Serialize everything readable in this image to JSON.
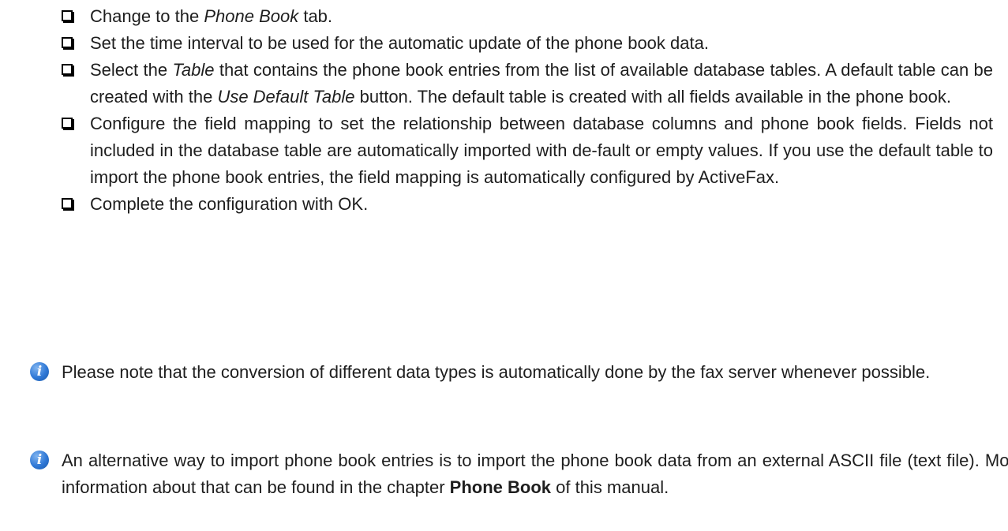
{
  "checklist": [
    {
      "a": "Change to the ",
      "b": "Phone Book",
      "c": " tab."
    },
    {
      "text": "Set the time interval to be used for the automatic update of the phone book data."
    },
    {
      "a": "Select the ",
      "b": "Table",
      "c": " that contains the phone book entries from the list of available database tables. A default table can be created with the ",
      "d": "Use Default Table",
      "e": " button. The default table is created with all fields available in the phone book."
    },
    {
      "text": "Configure the field mapping to set the relationship between database columns and phone book fields. Fields not included in the database table are automatically imported with de-fault or empty values. If you use the default table to import the phone book entries, the field mapping is automatically configured by ActiveFax."
    },
    {
      "text": "Complete the configuration with OK."
    }
  ],
  "notes": [
    {
      "icon": "info-icon",
      "text": "Please note that the conversion of different data types is automatically done by the fax server whenever possible."
    },
    {
      "icon": "info-icon",
      "a": "An alternative way to import phone book entries is to import the phone book data from an external ASCII file (text file). More information about that can be found in the chapter ",
      "b": "Phone Book",
      "c": " of this manual."
    }
  ]
}
